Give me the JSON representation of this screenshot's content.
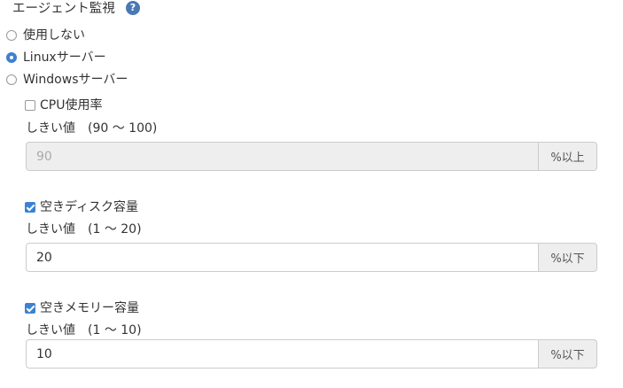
{
  "section": {
    "title": "エージェント監視",
    "help_icon": "question-circle-icon"
  },
  "radios": [
    {
      "label": "使用しない",
      "selected": false
    },
    {
      "label": "Linuxサーバー",
      "selected": true
    },
    {
      "label": "Windowsサーバー",
      "selected": false
    }
  ],
  "cpu": {
    "label": "CPU使用率",
    "checked": false,
    "threshold_label": "しきい値　(90 〜 100)",
    "value": "90",
    "unit": "%以上",
    "disabled": true
  },
  "disk": {
    "label": "空きディスク容量",
    "checked": true,
    "threshold_label": "しきい値　(1 〜 20)",
    "value": "20",
    "unit": "%以下"
  },
  "memory": {
    "label": "空きメモリー容量",
    "checked": true,
    "threshold_label": "しきい値　(1 〜 10)",
    "value": "10",
    "unit": "%以下"
  },
  "colors": {
    "accent": "#3b82cf",
    "help_icon": "#4a78b4",
    "addon_bg": "#eeeeee",
    "border": "#cccccc"
  }
}
